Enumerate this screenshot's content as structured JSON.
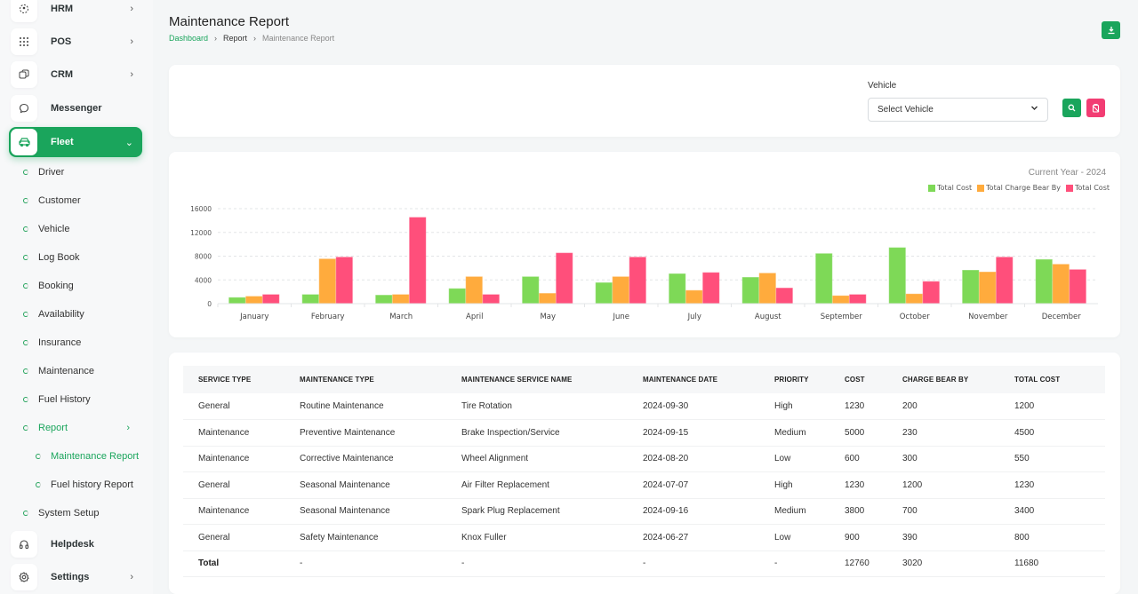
{
  "sidebar": {
    "top_items": [
      {
        "label": "HRM",
        "icon": "hrm-icon",
        "has_chevron": true
      },
      {
        "label": "POS",
        "icon": "grid-icon",
        "has_chevron": true
      },
      {
        "label": "CRM",
        "icon": "crm-icon",
        "has_chevron": true
      },
      {
        "label": "Messenger",
        "icon": "chat-icon",
        "has_chevron": false
      },
      {
        "label": "Fleet",
        "icon": "car-icon",
        "has_chevron": true,
        "active": true
      }
    ],
    "fleet_items": [
      {
        "label": "Driver"
      },
      {
        "label": "Customer"
      },
      {
        "label": "Vehicle"
      },
      {
        "label": "Log Book"
      },
      {
        "label": "Booking"
      },
      {
        "label": "Availability"
      },
      {
        "label": "Insurance"
      },
      {
        "label": "Maintenance"
      },
      {
        "label": "Fuel History"
      },
      {
        "label": "Report",
        "active": true
      },
      {
        "label": "System Setup"
      }
    ],
    "report_items": [
      {
        "label": "Maintenance Report",
        "active": true
      },
      {
        "label": "Fuel history Report"
      }
    ],
    "bottom_items": [
      {
        "label": "Helpdesk",
        "icon": "headset-icon"
      },
      {
        "label": "Settings",
        "icon": "gear-icon"
      }
    ]
  },
  "header": {
    "title": "Maintenance Report",
    "breadcrumb": [
      "Dashboard",
      "Report",
      "Maintenance Report"
    ],
    "download_icon": "download-icon"
  },
  "filter": {
    "vehicle_label": "Vehicle",
    "vehicle_select_value": "Select Vehicle"
  },
  "colors": {
    "primary": "#1aa55c",
    "danger": "#f23d73",
    "bar_green": "#7ed957",
    "bar_orange": "#ffab3d",
    "bar_pink": "#ff4f7b"
  },
  "chart_data": {
    "type": "bar",
    "title": "Current Year - 2024",
    "xlabel": "",
    "ylabel": "",
    "categories": [
      "January",
      "February",
      "March",
      "April",
      "May",
      "June",
      "July",
      "August",
      "September",
      "October",
      "November",
      "December"
    ],
    "series": [
      {
        "name": "Total Cost",
        "color": "#7ed957",
        "values": [
          1000,
          1500,
          1400,
          2500,
          4500,
          3500,
          5000,
          4400,
          8400,
          9400,
          5600,
          7400
        ]
      },
      {
        "name": "Total Charge Bear By",
        "color": "#ffab3d",
        "values": [
          1200,
          7500,
          1500,
          4500,
          1700,
          4500,
          2200,
          5100,
          1300,
          1600,
          5300,
          6600
        ]
      },
      {
        "name": "Total Cost",
        "color": "#ff4f7b",
        "values": [
          1500,
          7800,
          14500,
          1500,
          8500,
          7800,
          5200,
          2600,
          1500,
          3700,
          7800,
          5700
        ]
      }
    ],
    "ylim": [
      0,
      16000
    ],
    "yticks": [
      0,
      4000,
      8000,
      12000,
      16000
    ],
    "grid": true,
    "legend": "top-right"
  },
  "table": {
    "headers": [
      "SERVICE TYPE",
      "MAINTENANCE TYPE",
      "MAINTENANCE SERVICE NAME",
      "MAINTENANCE DATE",
      "PRIORITY",
      "COST",
      "CHARGE BEAR BY",
      "TOTAL COST"
    ],
    "rows": [
      [
        "General",
        "Routine Maintenance",
        "Tire Rotation",
        "2024-09-30",
        "High",
        "1230",
        "200",
        "1200"
      ],
      [
        "Maintenance",
        "Preventive Maintenance",
        "Brake Inspection/Service",
        "2024-09-15",
        "Medium",
        "5000",
        "230",
        "4500"
      ],
      [
        "Maintenance",
        "Corrective Maintenance",
        "Wheel Alignment",
        "2024-08-20",
        "Low",
        "600",
        "300",
        "550"
      ],
      [
        "General",
        "Seasonal Maintenance",
        "Air Filter Replacement",
        "2024-07-07",
        "High",
        "1230",
        "1200",
        "1230"
      ],
      [
        "Maintenance",
        "Seasonal Maintenance",
        "Spark Plug Replacement",
        "2024-09-16",
        "Medium",
        "3800",
        "700",
        "3400"
      ],
      [
        "General",
        "Safety Maintenance",
        "Knox Fuller",
        "2024-06-27",
        "Low",
        "900",
        "390",
        "800"
      ]
    ],
    "total": [
      "Total",
      "-",
      "-",
      "-",
      "-",
      "12760",
      "3020",
      "11680"
    ]
  }
}
